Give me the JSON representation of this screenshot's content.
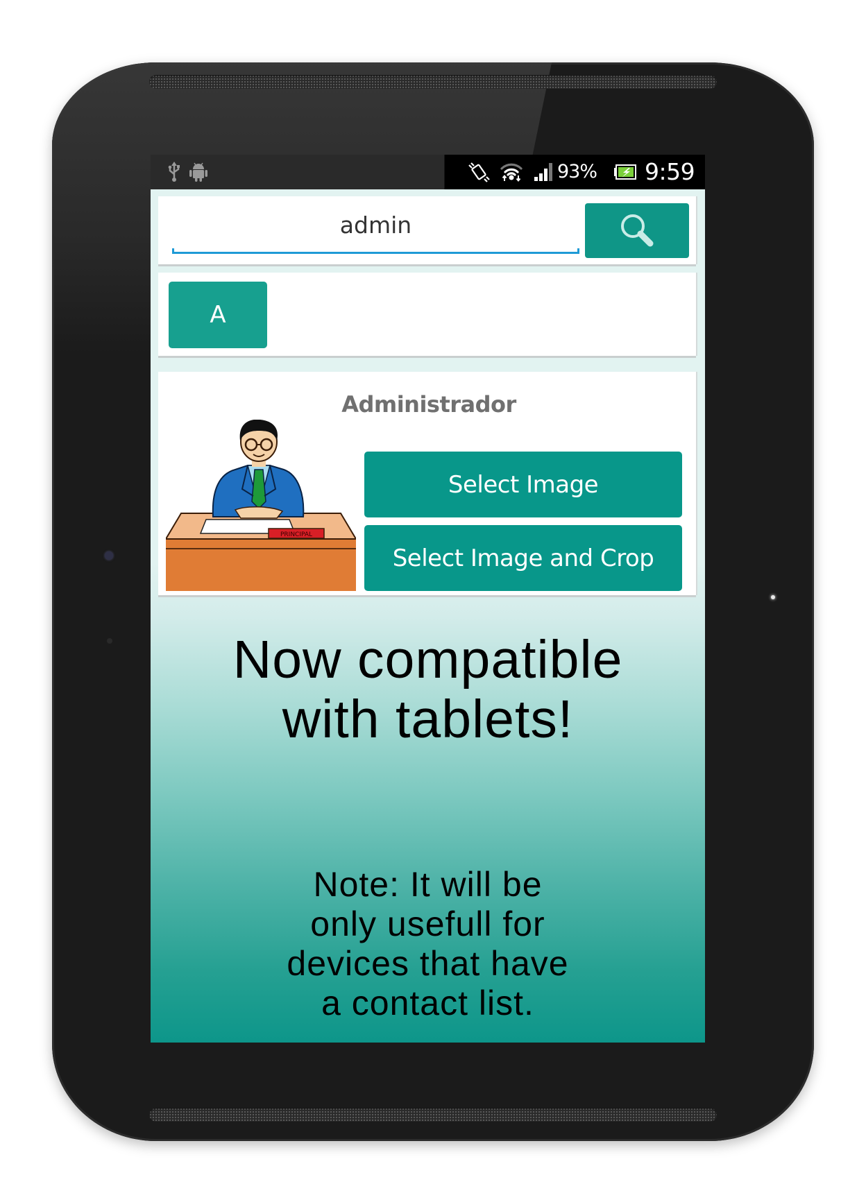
{
  "status_bar": {
    "left_icons": [
      "usb-icon",
      "android-debug-icon"
    ],
    "right_icons": [
      "vibrate-icon",
      "wifi-icon",
      "signal-icon",
      "battery-charging-icon"
    ],
    "battery_percent": "93%",
    "time": "9:59"
  },
  "search": {
    "value": "admin",
    "button_icon": "search-icon"
  },
  "letter_filter": {
    "label": "A"
  },
  "contact_card": {
    "title": "Administrador",
    "image_description": "cartoon principal at desk",
    "desk_sign_text": "PRINCIPAL",
    "select_image_label": "Select Image",
    "select_image_crop_label": "Select Image and Crop"
  },
  "promo": {
    "headline_lines": [
      "Now compatible",
      "with tablets!"
    ],
    "note_lines": [
      "Note: It will be",
      "only usefull for",
      "devices that have",
      "a contact list."
    ]
  },
  "colors": {
    "accent_teal": "#0f9687",
    "underline_blue": "#1e9ad6",
    "title_gray": "#707070"
  }
}
